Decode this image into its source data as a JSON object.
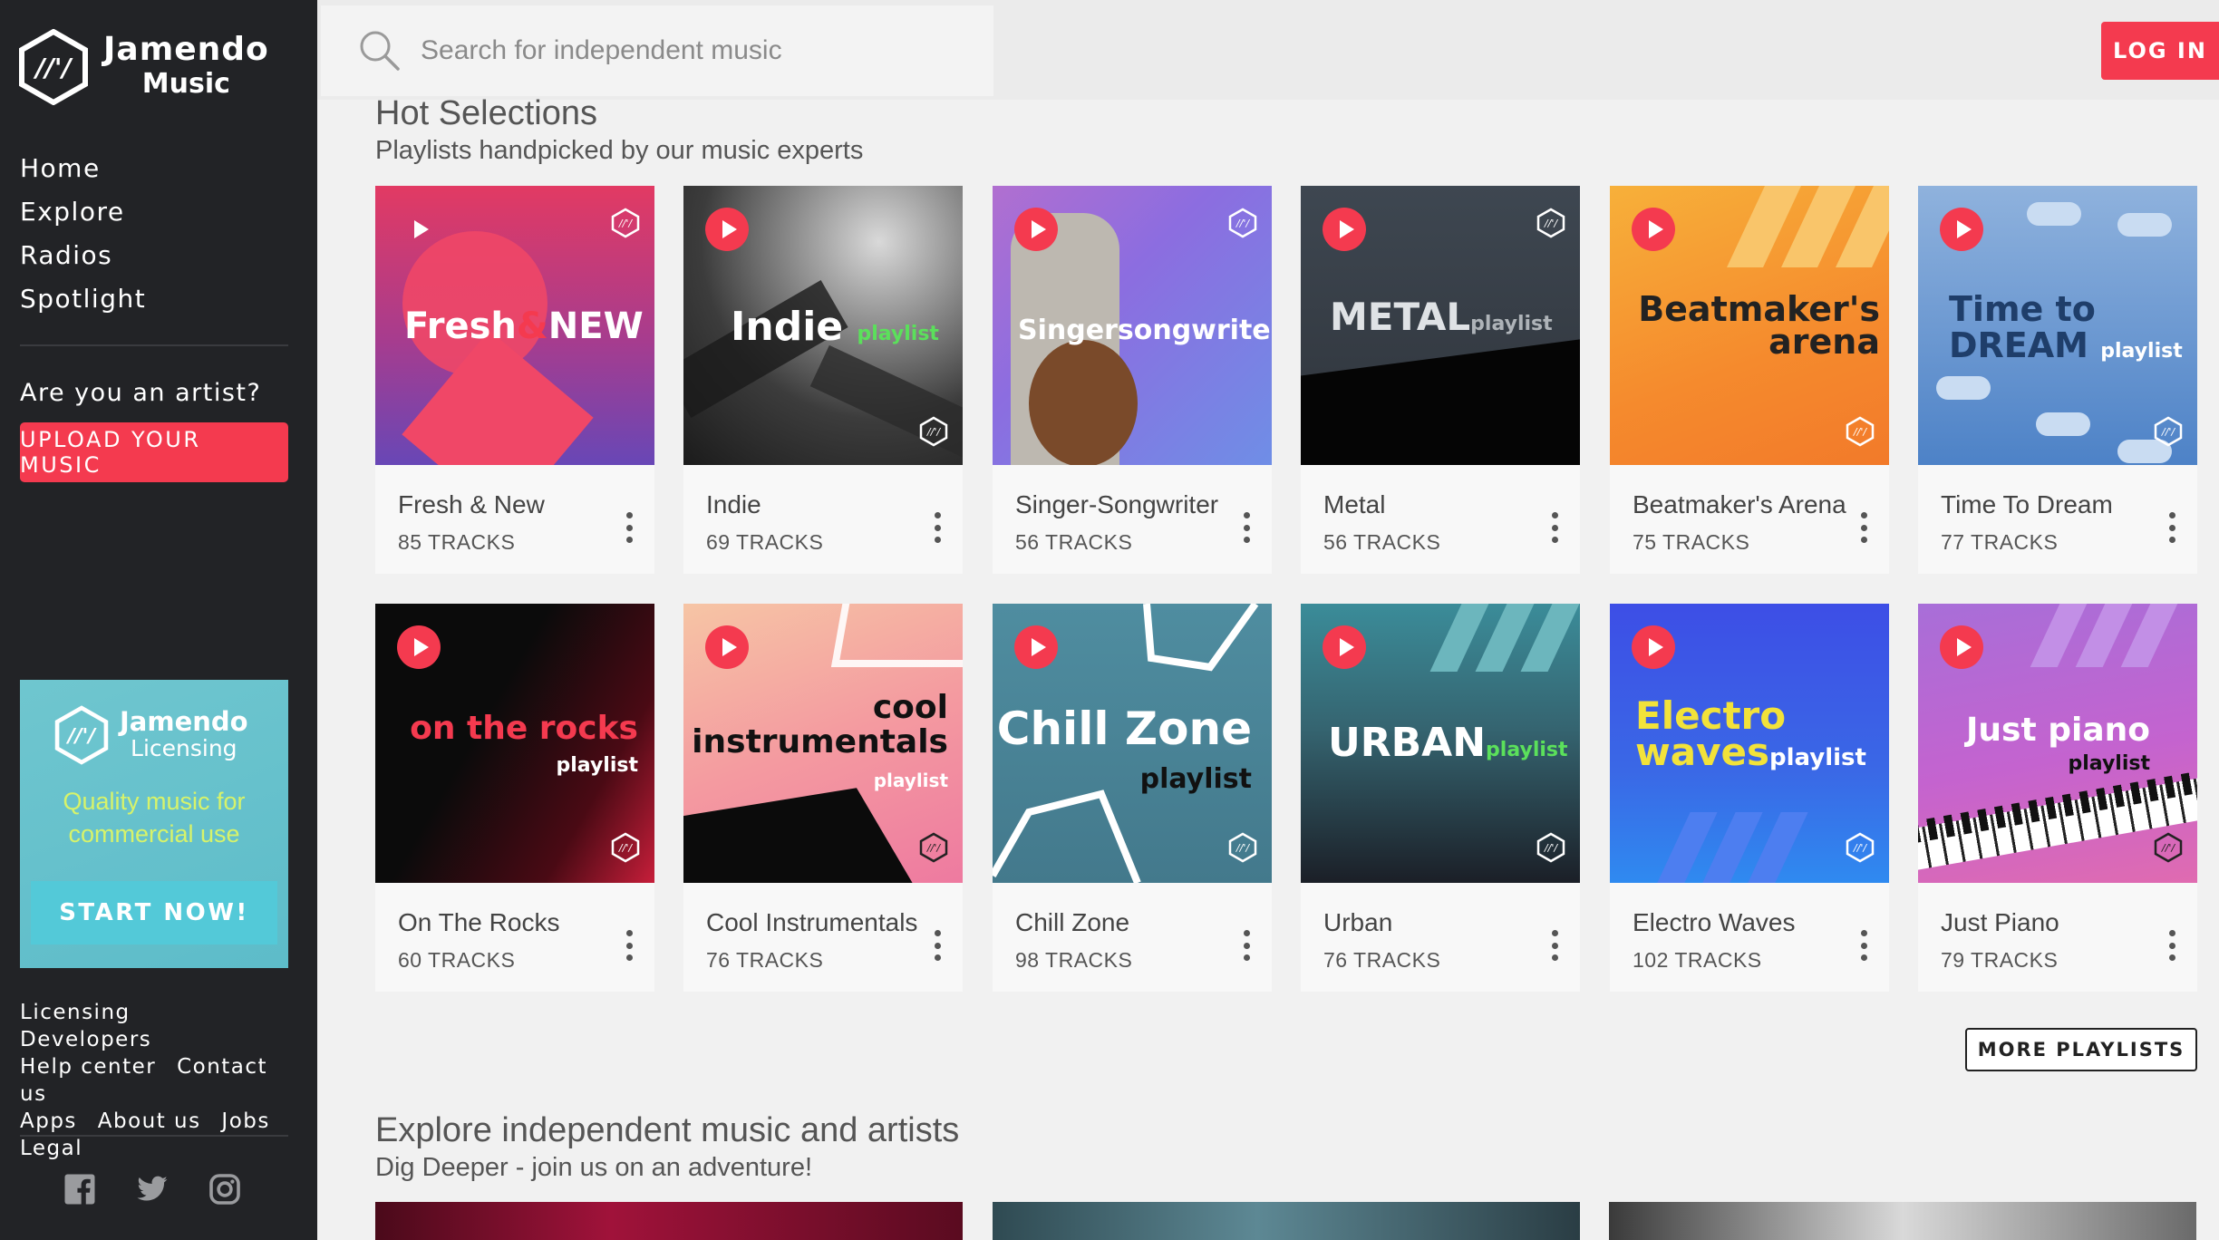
{
  "brand": {
    "line1": "Jamendo",
    "line2": "Music"
  },
  "nav": [
    "Home",
    "Explore",
    "Radios",
    "Spotlight"
  ],
  "artist": {
    "question": "Are you an artist?",
    "upload_label": "UPLOAD YOUR MUSIC"
  },
  "licensing": {
    "line1": "Jamendo",
    "line2": "Licensing",
    "tagline": "Quality music for commercial use",
    "cta": "START NOW!"
  },
  "footer_links": [
    "Licensing",
    "Developers",
    "Help center",
    "Contact us",
    "Apps",
    "About us",
    "Jobs",
    "Legal"
  ],
  "social": [
    "facebook-icon",
    "twitter-icon",
    "instagram-icon"
  ],
  "search": {
    "placeholder": "Search for independent music"
  },
  "login_label": "LOG IN",
  "hot": {
    "title": "Hot Selections",
    "subtitle": "Playlists handpicked by our music experts"
  },
  "playlists": [
    {
      "name": "Fresh & New",
      "count": "85 TRACKS"
    },
    {
      "name": "Indie",
      "count": "69 TRACKS"
    },
    {
      "name": "Singer-Songwriter",
      "count": "56 TRACKS"
    },
    {
      "name": "Metal",
      "count": "56 TRACKS"
    },
    {
      "name": "Beatmaker's Arena",
      "count": "75 TRACKS"
    },
    {
      "name": "Time To Dream",
      "count": "77 TRACKS"
    },
    {
      "name": "On The Rocks",
      "count": "60 TRACKS"
    },
    {
      "name": "Cool Instrumentals",
      "count": "76 TRACKS"
    },
    {
      "name": "Chill Zone",
      "count": "98 TRACKS"
    },
    {
      "name": "Urban",
      "count": "76 TRACKS"
    },
    {
      "name": "Electro Waves",
      "count": "102 TRACKS"
    },
    {
      "name": "Just Piano",
      "count": "79 TRACKS"
    }
  ],
  "cover_text": {
    "fresh_a": "Fresh",
    "fresh_b": "&",
    "fresh_c": "NEW",
    "indie": "Indie",
    "indie_small": "playlist",
    "singer": "Singersongwriter",
    "metal": "METAL",
    "metal_small": "playlist",
    "beat_1": "Beatmaker's",
    "beat_2": "arena",
    "dream_1": "Time to",
    "dream_2": "DREAM",
    "dream_small": "playlist",
    "rocks_1": "on the rocks",
    "rocks_2": "playlist",
    "cool_1": "cool",
    "cool_2": "instrumentals",
    "cool_3": "playlist",
    "chill_1": "Chill Zone",
    "chill_2": "playlist",
    "urban": "URBAN",
    "urban_small": "playlist",
    "electro_1": "Electro",
    "electro_2": "waves",
    "electro_small": "playlist",
    "piano_1": "Just piano",
    "piano_2": "playlist"
  },
  "more_label": "MORE PLAYLISTS",
  "explore": {
    "title": "Explore independent music and artists",
    "subtitle": "Dig Deeper - join us on an adventure!"
  },
  "colors": {
    "accent": "#f43a4f",
    "sidebar": "#222326",
    "licensing_bg": "#5dbcc9",
    "licensing_tagline": "#d7f36a"
  }
}
